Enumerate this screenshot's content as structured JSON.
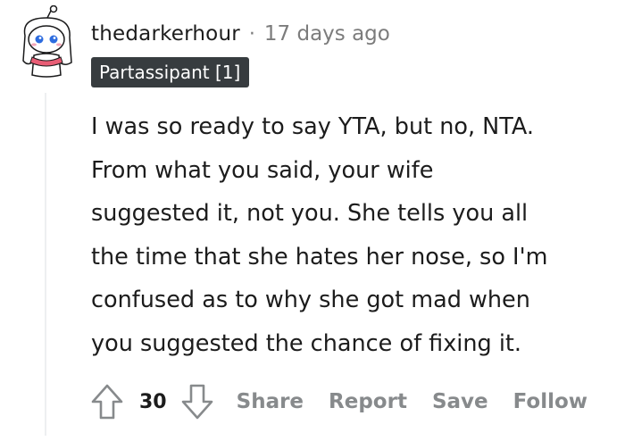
{
  "comment": {
    "username": "thedarkerhour",
    "separator": "·",
    "timestamp": "17 days ago",
    "flair": "Partassipant [1]",
    "body": "I was so ready to say YTA, but no, NTA.\nFrom what you said, your wife\nsuggested it, not you. She tells you all\nthe time that she hates her nose, so I'm\nconfused as to why she got mad when\nyou suggested the chance of fixing it.",
    "score": "30",
    "actions": {
      "share": "Share",
      "report": "Report",
      "save": "Save",
      "follow": "Follow"
    },
    "icons": {
      "avatar": "snoo-avatar-icon",
      "upvote": "upvote-arrow-icon",
      "downvote": "downvote-arrow-icon"
    },
    "colors": {
      "flair_bg": "#373c3f",
      "action_text": "#878a8c",
      "meta_text": "#7c7c7c"
    }
  }
}
